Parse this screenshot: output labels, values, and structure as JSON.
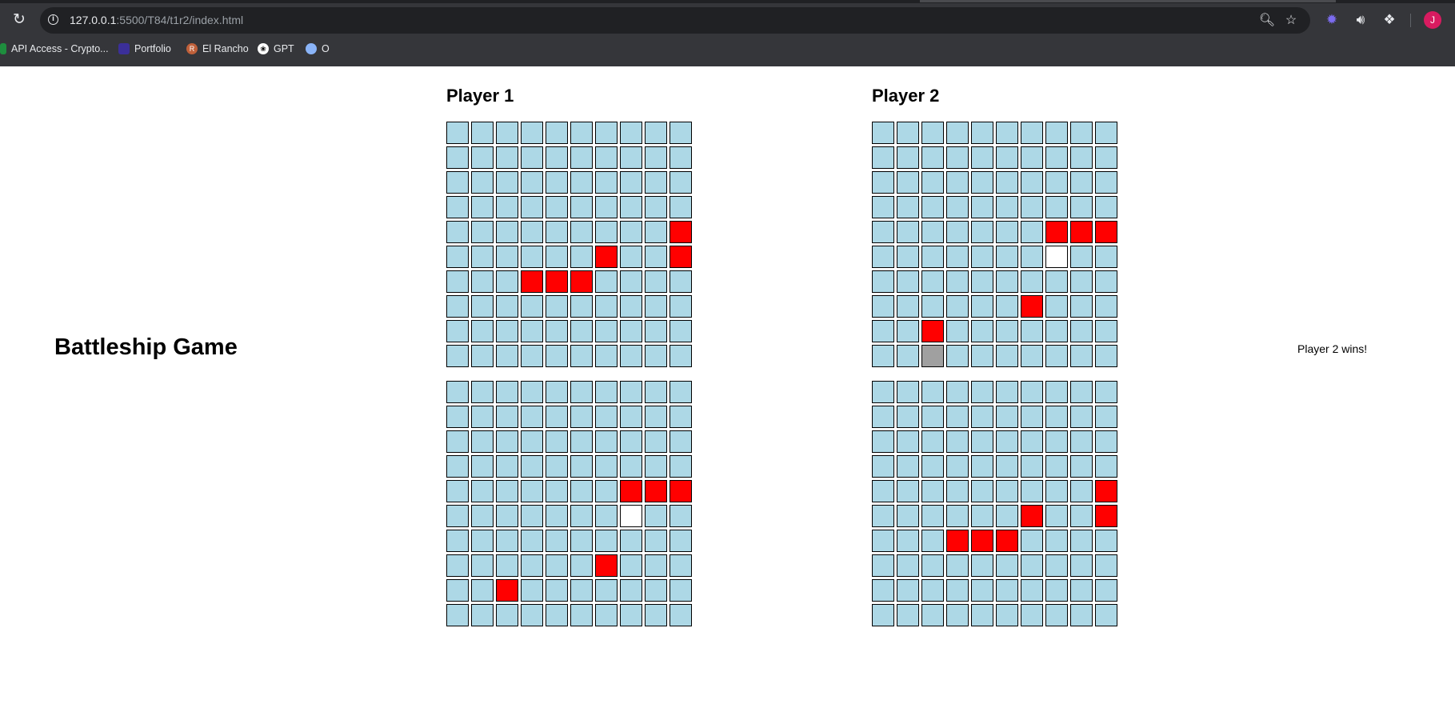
{
  "browser": {
    "url_host": "127.0.0.1",
    "url_path": ":5500/T84/t1r2/index.html",
    "profile_initial": "J",
    "bookmarks": [
      {
        "label": "API Access - Crypto...",
        "icon": "api-icon",
        "color": "#1e8e3e"
      },
      {
        "label": "Portfolio",
        "icon": "portfolio-icon",
        "color": "#3b2f99"
      },
      {
        "label": "El Rancho",
        "icon": "el-rancho-icon",
        "color": "#c0603a"
      },
      {
        "label": "GPT",
        "icon": "openai-icon",
        "color": "#ffffff"
      },
      {
        "label": "O",
        "icon": "o-icon",
        "color": "#8ab4f8"
      }
    ]
  },
  "page": {
    "title": "Battleship Game",
    "status": "Player 2 wins!"
  },
  "legend_colors": {
    "water": "#add8e6",
    "hit": "#ff0000",
    "miss": "#ffffff",
    "ship": "#a0a0a0"
  },
  "players": [
    {
      "name": "Player 1",
      "boards": [
        {
          "hits": [
            [
              4,
              9
            ],
            [
              5,
              6
            ],
            [
              5,
              9
            ],
            [
              6,
              3
            ],
            [
              6,
              4
            ],
            [
              6,
              5
            ]
          ],
          "misses": [],
          "ships": []
        },
        {
          "hits": [
            [
              4,
              7
            ],
            [
              4,
              8
            ],
            [
              4,
              9
            ],
            [
              7,
              6
            ],
            [
              8,
              2
            ]
          ],
          "misses": [
            [
              5,
              7
            ]
          ],
          "ships": []
        }
      ]
    },
    {
      "name": "Player 2",
      "boards": [
        {
          "hits": [
            [
              4,
              7
            ],
            [
              4,
              8
            ],
            [
              4,
              9
            ],
            [
              7,
              6
            ],
            [
              8,
              2
            ]
          ],
          "misses": [
            [
              5,
              7
            ]
          ],
          "ships": [
            [
              9,
              2
            ]
          ]
        },
        {
          "hits": [
            [
              4,
              9
            ],
            [
              5,
              6
            ],
            [
              5,
              9
            ],
            [
              6,
              3
            ],
            [
              6,
              4
            ],
            [
              6,
              5
            ]
          ],
          "misses": [],
          "ships": []
        }
      ]
    }
  ]
}
